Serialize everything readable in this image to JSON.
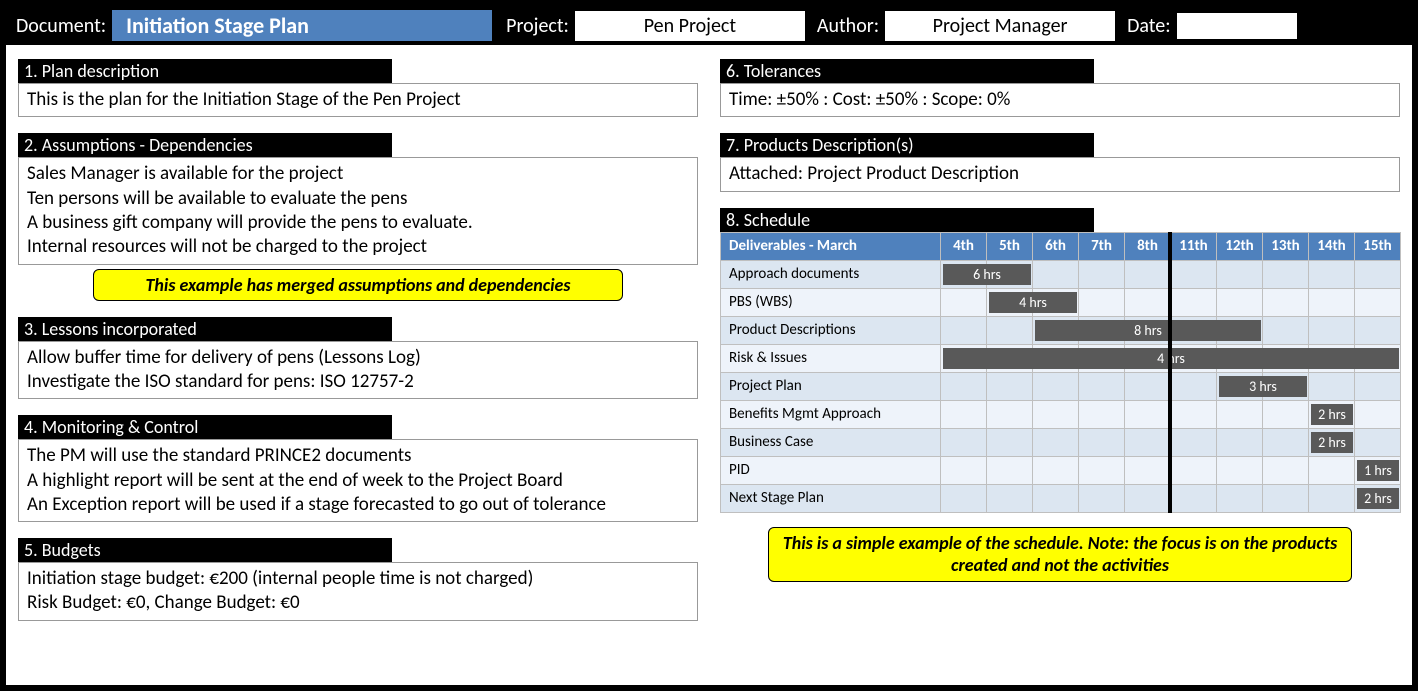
{
  "header": {
    "document_label": "Document:",
    "document_value": "Initiation Stage Plan",
    "project_label": "Project:",
    "project_value": "Pen Project",
    "author_label": "Author:",
    "author_value": "Project Manager",
    "date_label": "Date:",
    "date_value": ""
  },
  "left": {
    "s1": {
      "title": "1. Plan description",
      "body": "This is the plan for the Initiation Stage of the Pen Project"
    },
    "s2": {
      "title": "2. Assumptions - Dependencies",
      "lines": [
        "Sales Manager is available for the project",
        "Ten persons will be available to evaluate the pens",
        "A business gift company will provide the pens to evaluate.",
        "Internal resources will not be charged to the project"
      ],
      "callout": "This example has merged assumptions and dependencies"
    },
    "s3": {
      "title": "3. Lessons incorporated",
      "lines": [
        "Allow buffer time for delivery of pens (Lessons Log)",
        "Investigate the ISO standard for pens: ISO 12757-2"
      ]
    },
    "s4": {
      "title": "4. Monitoring & Control",
      "lines": [
        "The PM will use the standard PRINCE2 documents",
        "A highlight report will be sent at the end of week to the Project Board",
        "An Exception report will be used if a stage forecasted to go out of tolerance"
      ]
    },
    "s5": {
      "title": "5. Budgets",
      "lines": [
        "Initiation stage budget: €200 (internal people time is not charged)",
        "Risk Budget: €0,  Change Budget: €0"
      ]
    }
  },
  "right": {
    "s6": {
      "title": "6. Tolerances",
      "body": "Time: ±50% : Cost: ±50% : Scope: 0%"
    },
    "s7": {
      "title": "7. Products Description(s)",
      "body": "Attached: Project Product Description"
    },
    "s8": {
      "title": "8. Schedule",
      "callout": "This is a simple example of the schedule. Note: the focus is on the products created and not the activities"
    }
  },
  "chart_data": {
    "type": "table",
    "title": "Deliverables - March",
    "columns": [
      "4th",
      "5th",
      "6th",
      "7th",
      "8th",
      "11th",
      "12th",
      "13th",
      "14th",
      "15th"
    ],
    "rows": [
      {
        "name": "Approach documents",
        "start": 0,
        "span": 2,
        "label": "6 hrs"
      },
      {
        "name": "PBS (WBS)",
        "start": 1,
        "span": 2,
        "label": "4 hrs"
      },
      {
        "name": "Product Descriptions",
        "start": 2,
        "span": 5,
        "label": "8 hrs"
      },
      {
        "name": "Risk & Issues",
        "start": 0,
        "span": 10,
        "label": "4 hrs"
      },
      {
        "name": "Project Plan",
        "start": 6,
        "span": 2,
        "label": "3 hrs"
      },
      {
        "name": "Benefits Mgmt Approach",
        "start": 8,
        "span": 1,
        "label": "2 hrs"
      },
      {
        "name": "Business Case",
        "start": 8,
        "span": 1,
        "label": "2 hrs"
      },
      {
        "name": "PID",
        "start": 9,
        "span": 1,
        "label": "1 hrs"
      },
      {
        "name": "Next Stage Plan",
        "start": 9,
        "span": 1,
        "label": "2 hrs"
      }
    ],
    "today_marker_after_column_index": 5
  }
}
